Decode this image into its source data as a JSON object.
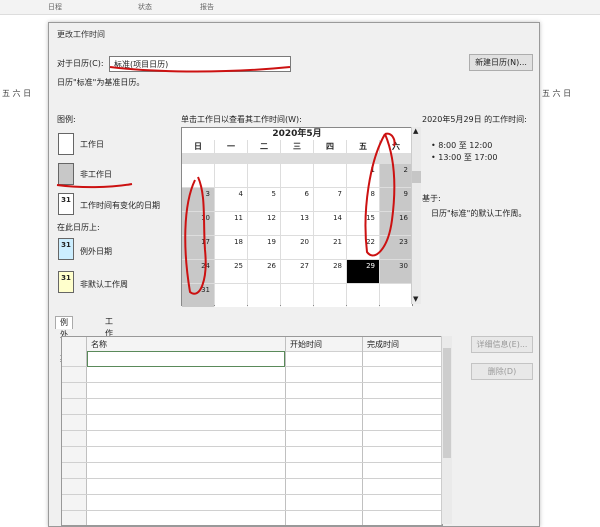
{
  "background": {
    "tabs": [
      "日程",
      "状态",
      "报告"
    ],
    "strip_left": "五 六 日",
    "strip_right": "五 六 日"
  },
  "dialog": {
    "title": "更改工作时间",
    "for_calendar_label": "对于日历(C):",
    "calendar_value": "标准(项目日历)",
    "new_calendar_button": "新建日历(N)...",
    "base_note": "日历\"标准\"为基准日历。",
    "legend": {
      "title": "图例:",
      "working": "工作日",
      "nonworking": "非工作日",
      "changed_hours": "工作时间有变化的日期",
      "changed_marker": "31",
      "on_this_calendar": "在此日历上:",
      "exception": "例外日期",
      "nondefault_week": "非默认工作周",
      "exception_marker": "31",
      "nondefault_marker": "31"
    },
    "instruction": "单击工作日以查看其工作时间(W):",
    "month_title": "2020年5月",
    "weekdays": [
      "日",
      "一",
      "二",
      "三",
      "四",
      "五",
      "六"
    ],
    "weeks": [
      [
        "",
        "",
        "",
        "",
        "",
        "1",
        "2"
      ],
      [
        "3",
        "4",
        "5",
        "6",
        "7",
        "8",
        "9"
      ],
      [
        "10",
        "11",
        "12",
        "13",
        "14",
        "15",
        "16"
      ],
      [
        "17",
        "18",
        "19",
        "20",
        "21",
        "22",
        "23"
      ],
      [
        "24",
        "25",
        "26",
        "27",
        "28",
        "29",
        "30"
      ],
      [
        "31",
        "",
        "",
        "",
        "",
        "",
        ""
      ]
    ],
    "selected_day": "29",
    "info": {
      "heading": "2020年5月29日 的工作时间:",
      "times": [
        "• 8:00 至 12:00",
        "• 13:00 至 17:00"
      ],
      "based_on_label": "基于:",
      "based_on_text": "日历\"标准\"的默认工作周。"
    },
    "tabs": [
      "例外日期",
      "工作周"
    ],
    "table_headers": [
      "名称",
      "开始时间",
      "完成时间"
    ],
    "details_button": "详细信息(E)...",
    "delete_button": "删除(D)"
  },
  "colors": {
    "ink": "#cc1111",
    "nonworking": "#c8c8c8",
    "exception_fill": "#cceeff",
    "nondefault_fill": "#ffffcc"
  }
}
